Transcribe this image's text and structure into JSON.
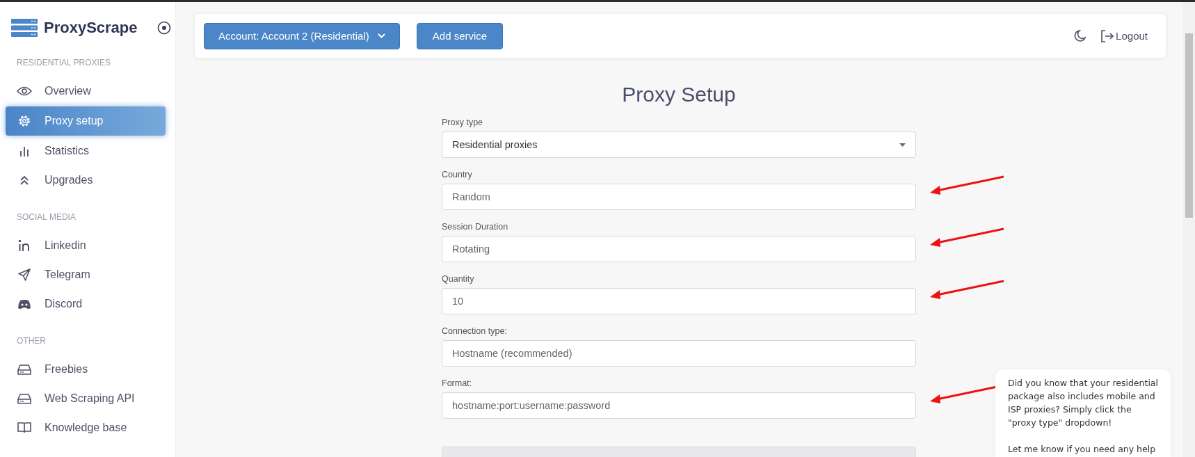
{
  "sidebar": {
    "brand": "ProxyScrape",
    "sections": [
      {
        "title": "RESIDENTIAL PROXIES",
        "items": [
          {
            "label": "Overview",
            "kind": "eye",
            "selected": false
          },
          {
            "label": "Proxy setup",
            "kind": "gear",
            "selected": true
          },
          {
            "label": "Statistics",
            "kind": "bars",
            "selected": false
          },
          {
            "label": "Upgrades",
            "kind": "chevrons",
            "selected": false
          }
        ]
      },
      {
        "title": "SOCIAL MEDIA",
        "items": [
          {
            "label": "Linkedin",
            "kind": "linkedin",
            "selected": false
          },
          {
            "label": "Telegram",
            "kind": "plane",
            "selected": false
          },
          {
            "label": "Discord",
            "kind": "discord",
            "selected": false
          }
        ]
      },
      {
        "title": "OTHER",
        "items": [
          {
            "label": "Freebies",
            "kind": "drive",
            "selected": false
          },
          {
            "label": "Web Scraping API",
            "kind": "drive",
            "selected": false
          },
          {
            "label": "Knowledge base",
            "kind": "book",
            "selected": false
          }
        ]
      }
    ]
  },
  "header": {
    "account_button": "Account: Account 2 (Residential)",
    "add_service_button": "Add service",
    "logout": "Logout"
  },
  "page_title": "Proxy Setup",
  "fields": [
    {
      "label": "Proxy type",
      "value": "Residential proxies",
      "kind": "select",
      "arrow": false
    },
    {
      "label": "Country",
      "value": "Random",
      "kind": "input",
      "arrow": true
    },
    {
      "label": "Session Duration",
      "value": "Rotating",
      "kind": "input",
      "arrow": true
    },
    {
      "label": "Quantity",
      "value": "10",
      "kind": "input",
      "arrow": true
    },
    {
      "label": "Connection type:",
      "value": "Hostname (recommended)",
      "kind": "input",
      "arrow": false
    },
    {
      "label": "Format:",
      "value": "hostname:port:username:password",
      "kind": "input",
      "arrow": true
    }
  ],
  "chat": {
    "paragraphs": [
      "Did you know that your residential package also includes mobile and ISP proxies? Simply click the \"proxy type\" dropdown!",
      "Let me know if you need any help"
    ]
  }
}
